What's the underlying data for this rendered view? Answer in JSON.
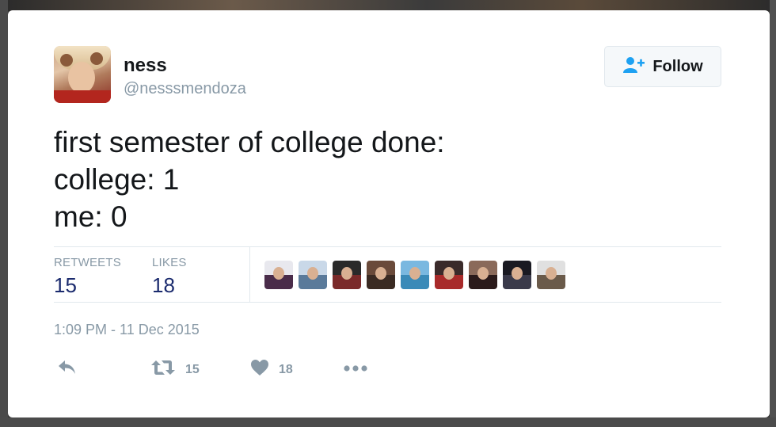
{
  "user": {
    "name": "ness",
    "handle": "@nesssmendoza"
  },
  "follow": {
    "label": "Follow"
  },
  "tweet": {
    "lines": [
      "first semester of college done:",
      "college: 1",
      "me: 0"
    ]
  },
  "stats": {
    "retweets_label": "RETWEETS",
    "retweets_count": "15",
    "likes_label": "LIKES",
    "likes_count": "18"
  },
  "timestamp": "1:09 PM - 11 Dec 2015",
  "actions": {
    "retweet_count": "15",
    "like_count": "18"
  },
  "colors": {
    "text": "#14171a",
    "muted": "#8899a6",
    "count": "#1b2b6e",
    "follow_icon": "#1da1f2"
  }
}
